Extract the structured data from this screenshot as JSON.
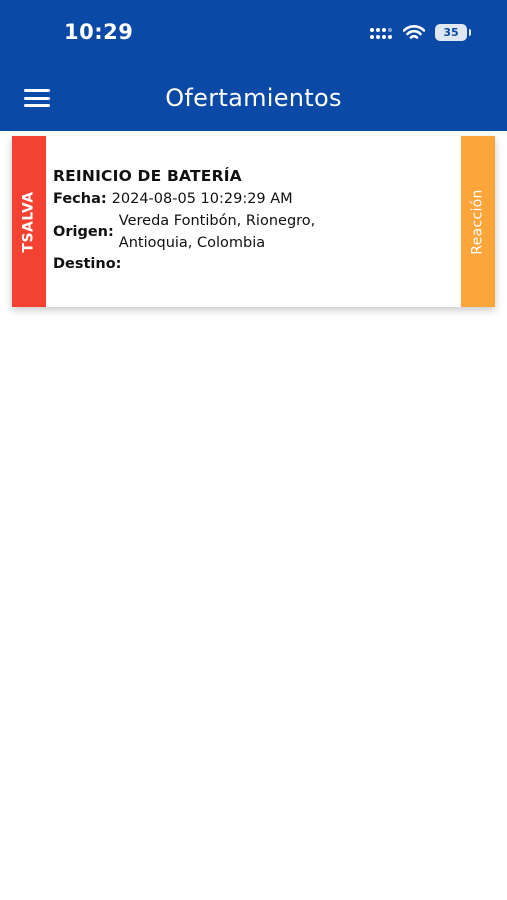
{
  "status_bar": {
    "time": "10:29",
    "battery": "35",
    "icons": [
      "signal-icon",
      "wifi-icon",
      "battery-icon"
    ]
  },
  "header": {
    "title": "Ofertamientos",
    "menu_icon": "hamburger-menu-icon",
    "color": "#0a4aa6"
  },
  "card": {
    "left_badge": "TSALVA",
    "left_badge_color": "#f34231",
    "title": "REINICIO DE BATERÍA",
    "fecha_label": "Fecha:",
    "fecha_value": "2024-08-05 10:29:29 AM",
    "origen_label": "Origen:",
    "origen_value": "Vereda Fontibón, Rionegro, Antioquia, Colombia",
    "destino_label": "Destino:",
    "destino_value": "",
    "right_badge": "Reacción",
    "right_badge_color": "#fba53a"
  }
}
